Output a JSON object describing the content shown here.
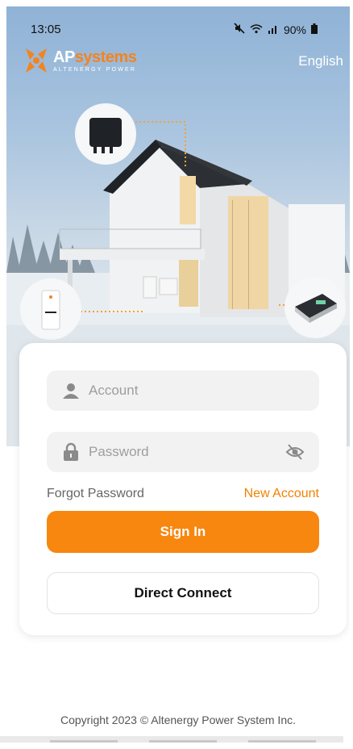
{
  "status_bar": {
    "time": "13:05",
    "battery": "90%",
    "icons": [
      "mute-icon",
      "wifi-icon",
      "signal-icon",
      "battery-icon"
    ]
  },
  "header": {
    "logo_ap": "AP",
    "logo_systems": "systems",
    "logo_tagline": "ALTENERGY POWER",
    "language": "English"
  },
  "login": {
    "account_placeholder": "Account",
    "account_value": "",
    "password_placeholder": "Password",
    "password_value": "",
    "forgot_label": "Forgot Password",
    "new_account_label": "New Account",
    "signin_label": "Sign In",
    "direct_connect_label": "Direct Connect"
  },
  "footer": {
    "copyright": "Copyright 2023 © Altenergy Power System Inc."
  },
  "colors": {
    "accent": "#f7870f",
    "link_accent": "#f08200",
    "field_bg": "#f2f2f2"
  }
}
